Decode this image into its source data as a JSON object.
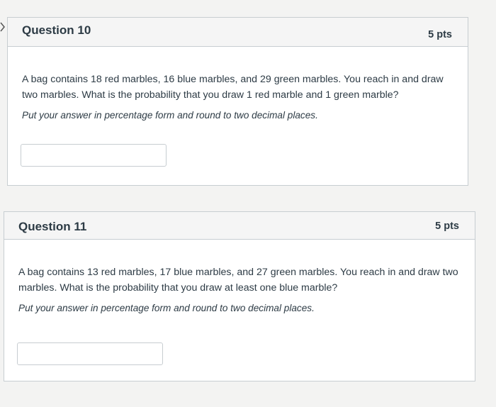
{
  "questions": [
    {
      "title": "Question 10",
      "points": "5 pts",
      "text": "A bag contains 18 red marbles, 16 blue marbles, and 29 green marbles. You reach in and draw two marbles. What is the probability that you draw 1 red marble and 1 green marble?",
      "instructions": "Put your answer in percentage form and round to two decimal places.",
      "answer_value": ""
    },
    {
      "title": "Question 11",
      "points": "5 pts",
      "text": "A bag contains 13 red marbles, 17 blue marbles, and 27 green marbles. You reach in and draw two marbles. What is the probability that you draw at least one blue marble?",
      "instructions": "Put your answer in percentage form and round to two decimal places.",
      "answer_value": ""
    }
  ],
  "icons": {
    "nav": "chevron-right-icon"
  },
  "colors": {
    "page_bg": "#f3f3f2",
    "card_bg": "#ffffff",
    "header_bg": "#f5f5f5",
    "border": "#c7cdd1",
    "text": "#2d3b45"
  }
}
